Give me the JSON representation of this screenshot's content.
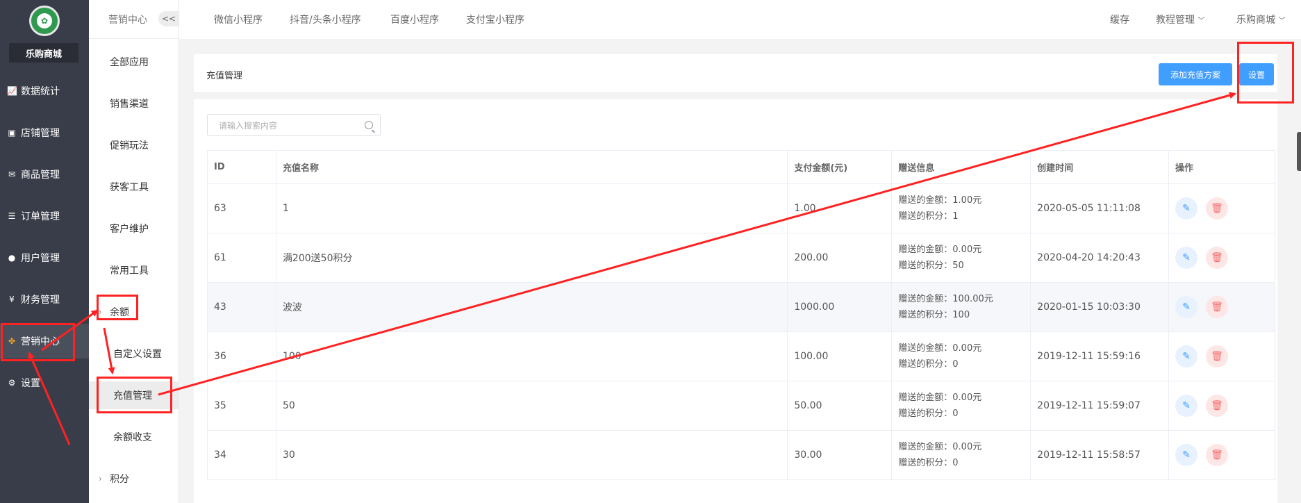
{
  "app": {
    "shop_name": "乐购商城",
    "logo_icon": "shop-logo-icon"
  },
  "sidebar": {
    "items": [
      {
        "label": "数据统计",
        "icon": "chart-icon",
        "glyph": "📈"
      },
      {
        "label": "店铺管理",
        "icon": "store-icon",
        "glyph": "▣"
      },
      {
        "label": "商品管理",
        "icon": "mail-icon",
        "glyph": "✉"
      },
      {
        "label": "订单管理",
        "icon": "list-icon",
        "glyph": "☰"
      },
      {
        "label": "用户管理",
        "icon": "user-icon",
        "glyph": "●"
      },
      {
        "label": "财务管理",
        "icon": "finance-icon",
        "glyph": "¥"
      },
      {
        "label": "营销中心",
        "icon": "marketing-icon",
        "glyph": "✤"
      },
      {
        "label": "设置",
        "icon": "gear-icon",
        "glyph": "⚙"
      }
    ]
  },
  "subnav": {
    "title": "营销中心",
    "collapse": "<<",
    "items": [
      "全部应用",
      "销售渠道",
      "促销玩法",
      "获客工具",
      "客户维护",
      "常用工具"
    ],
    "balance": "余额",
    "balance_children": [
      "自定义设置",
      "充值管理",
      "余额收支"
    ],
    "points": "积分"
  },
  "topbar": {
    "tabs": [
      "微信小程序",
      "抖音/头条小程序",
      "百度小程序",
      "支付宝小程序"
    ],
    "right": [
      "缓存",
      "教程管理",
      "乐购商城"
    ]
  },
  "page": {
    "title": "充值管理",
    "add_button": "添加充值方案",
    "settings_button": "设置",
    "search_placeholder": "请输入搜索内容"
  },
  "table": {
    "headers": [
      "ID",
      "充值名称",
      "支付金额(元)",
      "赠送信息",
      "创建时间",
      "操作"
    ],
    "rows": [
      {
        "id": "63",
        "name": "1",
        "amount": "1.00",
        "gift_money": "赠送的金额：1.00元",
        "gift_points": "赠送的积分：1",
        "created": "2020-05-05 11:11:08"
      },
      {
        "id": "61",
        "name": "满200送50积分",
        "amount": "200.00",
        "gift_money": "赠送的金额：0.00元",
        "gift_points": "赠送的积分：50",
        "created": "2020-04-20 14:20:43"
      },
      {
        "id": "43",
        "name": "波波",
        "amount": "1000.00",
        "gift_money": "赠送的金额：100.00元",
        "gift_points": "赠送的积分：100",
        "created": "2020-01-15 10:03:30"
      },
      {
        "id": "36",
        "name": "100",
        "amount": "100.00",
        "gift_money": "赠送的金额：0.00元",
        "gift_points": "赠送的积分：0",
        "created": "2019-12-11 15:59:16"
      },
      {
        "id": "35",
        "name": "50",
        "amount": "50.00",
        "gift_money": "赠送的金额：0.00元",
        "gift_points": "赠送的积分：0",
        "created": "2019-12-11 15:59:07"
      },
      {
        "id": "34",
        "name": "30",
        "amount": "30.00",
        "gift_money": "赠送的金额：0.00元",
        "gift_points": "赠送的积分：0",
        "created": "2019-12-11 15:58:57"
      }
    ]
  },
  "colors": {
    "sidebar": "#393d49",
    "accent": "#409eff",
    "annotation": "#ff2222",
    "delete": "#f56c6c"
  }
}
